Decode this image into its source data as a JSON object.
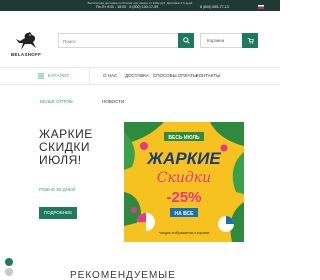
{
  "topbar": {
    "notice": "Бесплатная доставка по России при заказе от 1000 руб. Доставка 2-5 дней",
    "left_info": "Пн-Пт 9:00 - 18:00   ·   8 (800) 100-17-59",
    "right_info": "8 (800) 555-77-13"
  },
  "header": {
    "logo_text": "BELASHOFF",
    "search_placeholder": "Поиск",
    "cart_label": "Корзина"
  },
  "nav": {
    "catalog": "КАТАЛОГ",
    "items": [
      "О НАС",
      "ДОСТАВКА",
      "СПОСОБЫ ОПЛАТЫ",
      "КОНТАКТЫ"
    ]
  },
  "sidebar": {
    "category_link": "БЕЛЬЕ ОПТОМ"
  },
  "hero": {
    "title": "ЖАРКИЕ СКИДКИ ИЮЛЯ!",
    "subtitle": "РОВНО 90 ДНЕЙ",
    "button": "ПОДРОБНЕЕ"
  },
  "news": {
    "label": "НОВОСТИ"
  },
  "banner": {
    "top_text": "ВЕСЬ ИЮЛЬ",
    "headline": "ЖАРКИЕ",
    "script_word": "Скидки",
    "discount": "-25%",
    "tag": "НА ВСЕ",
    "footnote": "*скидка отображается в корзине"
  },
  "section": {
    "recommended": "РЕКОМЕНДУЕМЫЕ"
  },
  "colors": {
    "brand_green": "#1d7a5f",
    "accent_green": "#2aa57a",
    "banner_yellow": "#f5c21f",
    "banner_pink": "#e8358e",
    "banner_blue": "#1b6fb5"
  }
}
